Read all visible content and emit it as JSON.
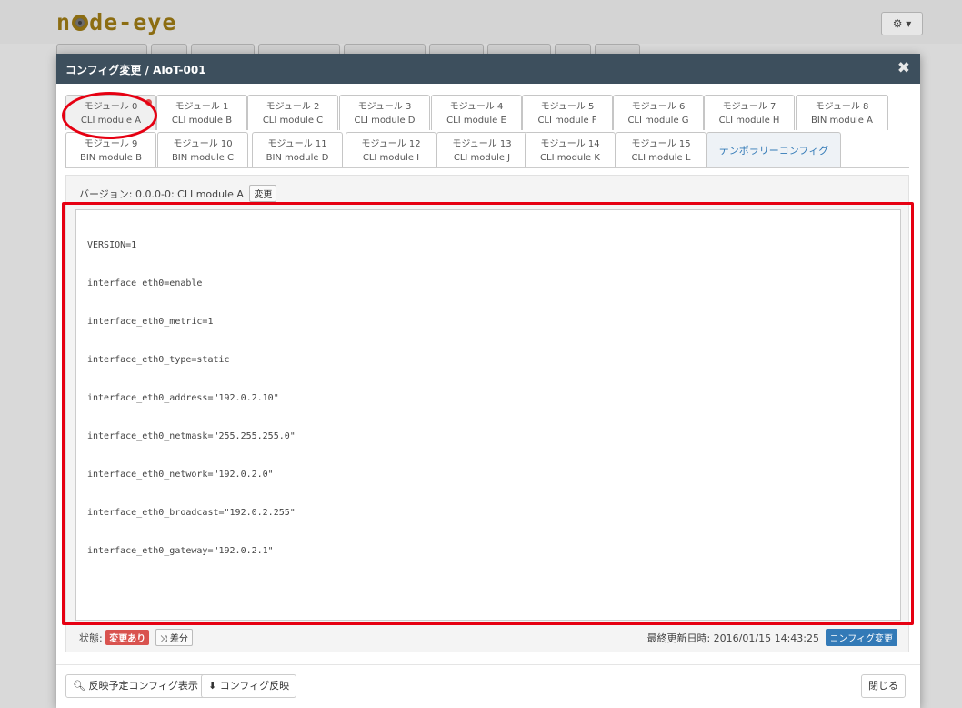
{
  "app": {
    "logo_text_before": "n",
    "logo_text_after": "de-eye",
    "settings_caret": "▾"
  },
  "modal": {
    "title": "コンフィグ変更 / AIoT-001",
    "close": "✖"
  },
  "tabs": [
    {
      "line1": "モジュール 0",
      "line2": "CLI module A"
    },
    {
      "line1": "モジュール 1",
      "line2": "CLI module B"
    },
    {
      "line1": "モジュール 2",
      "line2": "CLI module C"
    },
    {
      "line1": "モジュール 3",
      "line2": "CLI module D"
    },
    {
      "line1": "モジュール 4",
      "line2": "CLI module E"
    },
    {
      "line1": "モジュール 5",
      "line2": "CLI module F"
    },
    {
      "line1": "モジュール 6",
      "line2": "CLI module G"
    },
    {
      "line1": "モジュール 7",
      "line2": "CLI module H"
    },
    {
      "line1": "モジュール 8",
      "line2": "BIN module A"
    },
    {
      "line1": "モジュール 9",
      "line2": "BIN module B"
    },
    {
      "line1": "モジュール 10",
      "line2": "BIN module C"
    },
    {
      "line1": "モジュール 11",
      "line2": "BIN module D"
    },
    {
      "line1": "モジュール 12",
      "line2": "CLI module I"
    },
    {
      "line1": "モジュール 13",
      "line2": "CLI module J"
    },
    {
      "line1": "モジュール 14",
      "line2": "CLI module K"
    },
    {
      "line1": "モジュール 15",
      "line2": "CLI module L"
    },
    {
      "line1": "テンポラリーコンフィグ",
      "line2": ""
    }
  ],
  "version": {
    "label": "バージョン: 0.0.0-0: CLI module A",
    "change_button": "変更"
  },
  "editor": {
    "lines": [
      "VERSION=1",
      "interface_eth0=enable",
      "interface_eth0_metric=1",
      "interface_eth0_type=static",
      "interface_eth0_address=\"192.0.2.10\"",
      "interface_eth0_netmask=\"255.255.255.0\"",
      "interface_eth0_network=\"192.0.2.0\"",
      "interface_eth0_broadcast=\"192.0.2.255\"",
      "interface_eth0_gateway=\"192.0.2.1\""
    ]
  },
  "status": {
    "label": "状態:",
    "changed_badge": "変更あり",
    "diff_button": "差分",
    "last_updated": "最終更新日時: 2016/01/15 14:43:25",
    "config_change_button": "コンフィグ変更"
  },
  "footer": {
    "preview_button": "反映予定コンフィグ表示",
    "apply_button": "コンフィグ反映",
    "close_button": "閉じる"
  },
  "colors": {
    "header_bg": "#3d4f5d",
    "accent_red": "#e60012",
    "badge_red": "#d9534f",
    "button_blue": "#337ab7",
    "logo_gold": "#8c6d12"
  }
}
